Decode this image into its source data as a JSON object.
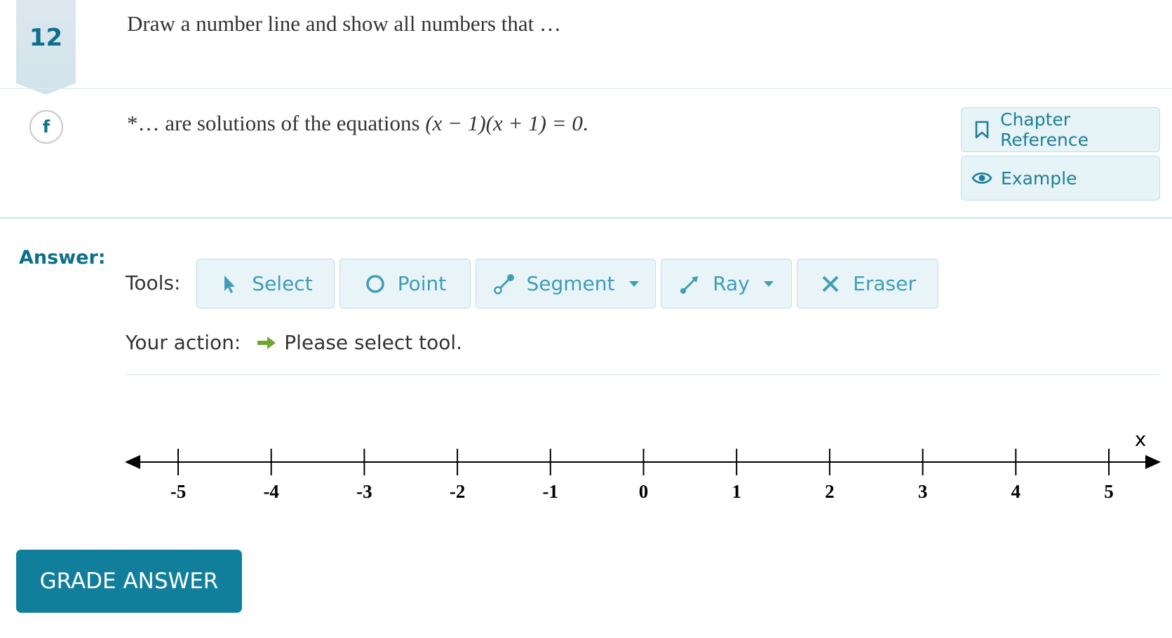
{
  "question": {
    "number": "12",
    "prompt": "Draw a number line and show all numbers that …"
  },
  "part": {
    "letter": "f",
    "text_prefix": "*… are solutions of the equations ",
    "equation": "(x − 1)(x + 1) = 0",
    "text_suffix": "."
  },
  "side_buttons": {
    "chapter_reference": {
      "label": "Chapter Reference",
      "icon": "bookmark-icon"
    },
    "example": {
      "label": "Example",
      "icon": "eye-icon"
    }
  },
  "answer": {
    "label": "Answer:",
    "tools_label": "Tools:",
    "tools": [
      {
        "label": "Select",
        "icon": "pointer-icon",
        "has_dropdown": false
      },
      {
        "label": "Point",
        "icon": "circle-point-icon",
        "has_dropdown": false
      },
      {
        "label": "Segment",
        "icon": "segment-icon",
        "has_dropdown": true
      },
      {
        "label": "Ray",
        "icon": "ray-icon",
        "has_dropdown": true
      },
      {
        "label": "Eraser",
        "icon": "x-eraser-icon",
        "has_dropdown": false
      }
    ],
    "action_label": "Your action:",
    "action_status": "Please select tool.",
    "action_arrow_color": "#6aa832"
  },
  "number_line": {
    "axis_label": "x",
    "ticks": [
      "-5",
      "-4",
      "-3",
      "-2",
      "-1",
      "0",
      "1",
      "2",
      "3",
      "4",
      "5"
    ],
    "min": -5,
    "max": 5
  },
  "grade_button": {
    "label": "GRADE ANSWER"
  },
  "colors": {
    "brand": "#117f9b",
    "accent_text": "#0e6f8a",
    "tool_text": "#3f9db6",
    "tool_bg": "#e8f4f8",
    "status_arrow": "#6aa832"
  }
}
